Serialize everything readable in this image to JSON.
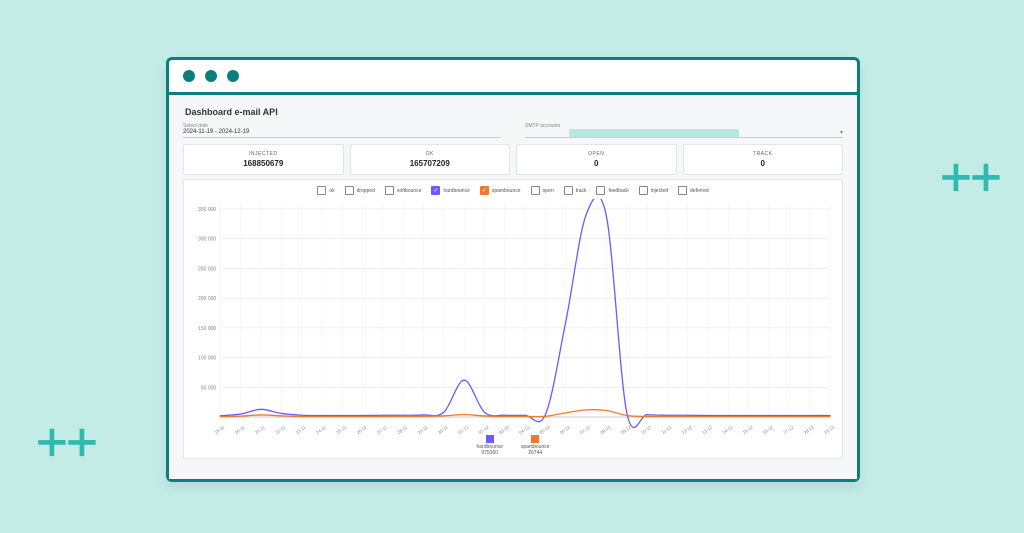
{
  "page_title": "Dashboard e-mail API",
  "filters": {
    "date_label": "Select date",
    "date_value": "2024-11-19 - 2024-12-19",
    "smtp_label": "SMTP accounts",
    "smtp_value": ""
  },
  "kpi": [
    {
      "label": "INJECTED",
      "value": "168850679"
    },
    {
      "label": "OK",
      "value": "165707209"
    },
    {
      "label": "OPEN",
      "value": "0"
    },
    {
      "label": "TRACK",
      "value": "0"
    }
  ],
  "legend_items": [
    {
      "name": "ok",
      "checked": false
    },
    {
      "name": "dropped",
      "checked": false
    },
    {
      "name": "softbounce",
      "checked": false
    },
    {
      "name": "hardbounce",
      "checked": true,
      "color": "purple"
    },
    {
      "name": "spambounce",
      "checked": true,
      "color": "orange"
    },
    {
      "name": "open",
      "checked": false
    },
    {
      "name": "track",
      "checked": false
    },
    {
      "name": "feedback",
      "checked": false
    },
    {
      "name": "injected",
      "checked": false
    },
    {
      "name": "deferred",
      "checked": false
    }
  ],
  "legend_totals": {
    "hardbounce": "975360",
    "spambounce": "26744"
  },
  "chart_data": {
    "type": "line",
    "title": "",
    "xlabel": "",
    "ylabel": "",
    "ylim": [
      0,
      360000
    ],
    "y_ticks": [
      0,
      50000,
      100000,
      150000,
      200000,
      250000,
      300000,
      350000
    ],
    "y_tick_labels": [
      "",
      "50 000",
      "100 000",
      "150 000",
      "200 000",
      "250 000",
      "300 000",
      "350 000"
    ],
    "categories": [
      "19-11",
      "20-11",
      "21-11",
      "22-11",
      "23-11",
      "24-11",
      "25-11",
      "26-11",
      "27-11",
      "28-11",
      "29-11",
      "30-11",
      "01-12",
      "02-12",
      "03-12",
      "04-12",
      "05-12",
      "06-12",
      "07-12",
      "08-12",
      "09-12",
      "10-12",
      "11-12",
      "12-12",
      "13-12",
      "14-12",
      "15-12",
      "16-12",
      "17-12",
      "18-12",
      "19-12"
    ],
    "series": [
      {
        "name": "hardbounce",
        "color": "#6a5cff",
        "values": [
          2000,
          5000,
          13000,
          6000,
          3000,
          2500,
          2500,
          2500,
          3000,
          3000,
          3500,
          8000,
          62000,
          8000,
          3000,
          3000,
          4000,
          160000,
          340000,
          338000,
          8000,
          4000,
          3000,
          3000,
          2500,
          2500,
          2500,
          2500,
          2500,
          2500,
          2500
        ]
      },
      {
        "name": "spambounce",
        "color": "#f07a2c",
        "values": [
          500,
          1500,
          3500,
          2000,
          800,
          700,
          700,
          700,
          800,
          900,
          1200,
          2000,
          4000,
          1800,
          900,
          900,
          1200,
          7000,
          12000,
          11000,
          2500,
          1000,
          800,
          700,
          700,
          700,
          700,
          700,
          700,
          700,
          700
        ]
      }
    ]
  }
}
